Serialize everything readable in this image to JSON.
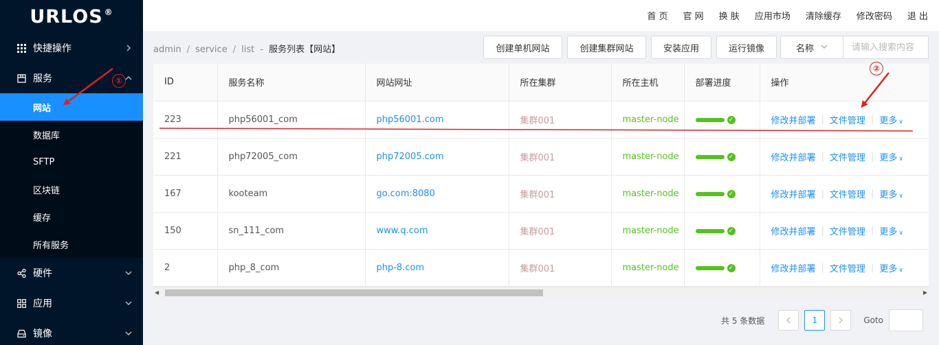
{
  "app": {
    "logo": "URLOS",
    "logo_mark": "®"
  },
  "topnav": [
    "首 页",
    "官 网",
    "换 肤",
    "应用市场",
    "清除缓存",
    "修改密码",
    "退 出"
  ],
  "sidebar": {
    "groups": [
      {
        "label": "快捷操作",
        "icon": "grid-icon"
      },
      {
        "label": "服务",
        "icon": "server-icon",
        "expanded": true
      },
      {
        "label": "硬件",
        "icon": "share-nodes-icon"
      },
      {
        "label": "应用",
        "icon": "apps-icon"
      },
      {
        "label": "镜像",
        "icon": "disk-icon"
      }
    ],
    "service_items": [
      "网站",
      "数据库",
      "SFTP",
      "区块链",
      "缓存",
      "所有服务"
    ],
    "active_item": "网站"
  },
  "breadcrumb": {
    "parts": [
      "admin",
      "service",
      "list"
    ],
    "dash": "-",
    "current": "服务列表【网站】"
  },
  "toolbar": {
    "buttons": [
      "创建单机网站",
      "创建集群网站",
      "安装应用",
      "运行镜像"
    ],
    "select_value": "名称",
    "search_placeholder": "请输入搜索内容"
  },
  "table": {
    "headers": [
      "ID",
      "服务名称",
      "网站网址",
      "所在集群",
      "所在主机",
      "部署进度",
      "操作"
    ],
    "rows": [
      {
        "id": "223",
        "name": "php56001_com",
        "url": "php56001.com",
        "cluster": "集群001",
        "host": "master-node"
      },
      {
        "id": "221",
        "name": "php72005_com",
        "url": "php72005.com",
        "cluster": "集群001",
        "host": "master-node"
      },
      {
        "id": "167",
        "name": "kooteam",
        "url": "go.com:8080",
        "cluster": "集群001",
        "host": "master-node"
      },
      {
        "id": "150",
        "name": "sn_111_com",
        "url": "www.q.com",
        "cluster": "集群001",
        "host": "master-node"
      },
      {
        "id": "2",
        "name": "php_8_com",
        "url": "php-8.com",
        "cluster": "集群001",
        "host": "master-node"
      }
    ],
    "progress": 1.0,
    "ops": {
      "edit": "修改并部署",
      "files": "文件管理",
      "more": "更多"
    }
  },
  "pagination": {
    "total_text": "共 5 条数据",
    "current_page": "1",
    "goto_label": "Goto"
  },
  "annotations": {
    "badge1": "①",
    "badge2": "②"
  },
  "colors": {
    "sidebar_bg": "#001529",
    "active": "#1890ff",
    "success": "#52c41a",
    "annotation": "#e02020"
  }
}
